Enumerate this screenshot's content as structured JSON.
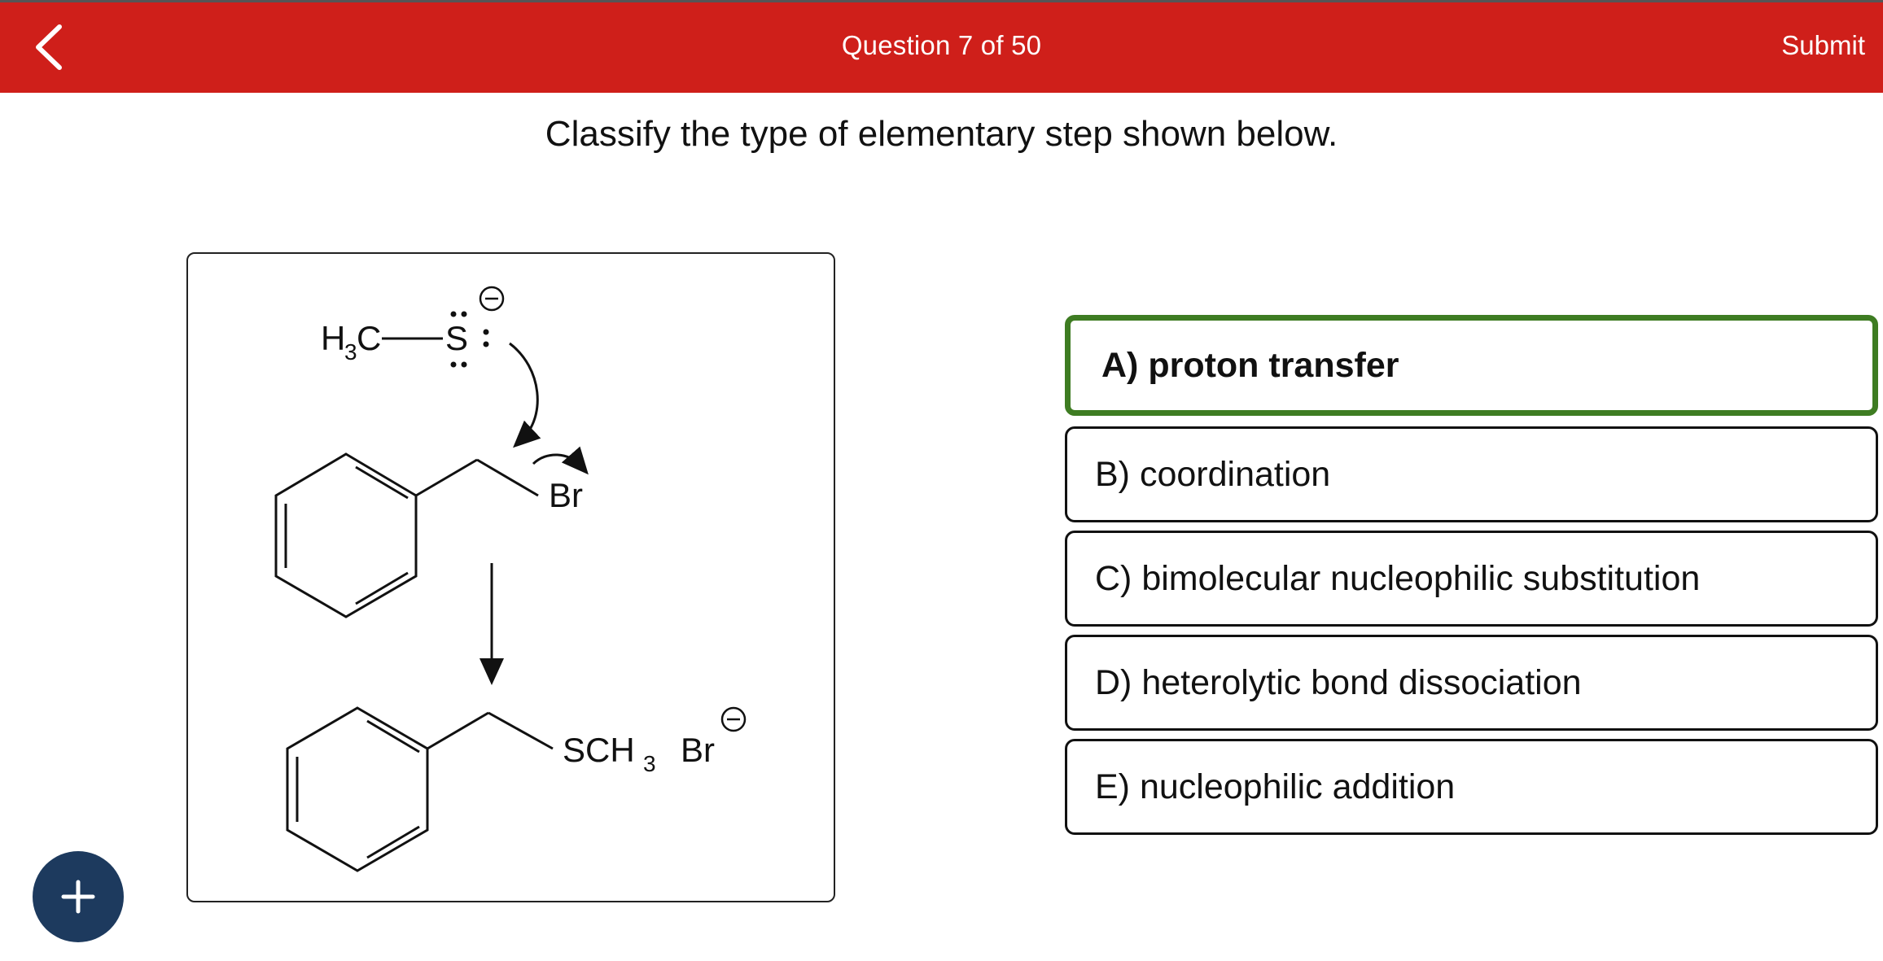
{
  "header": {
    "title": "Question 7 of 50",
    "submit_label": "Submit",
    "accent_color": "#cf1f1a"
  },
  "question": {
    "prompt": "Classify the type of elementary step shown below."
  },
  "diagram": {
    "reactant_methyl": "H",
    "reactant_methyl_sub": "3",
    "reactant_methyl_c": "C",
    "sulfur": "S",
    "leaving_group": "Br",
    "product_group_main": "SCH",
    "product_group_sub": "3",
    "bromide": "Br"
  },
  "options": [
    {
      "label": "A) proton transfer",
      "selected": true
    },
    {
      "label": "B) coordination",
      "selected": false
    },
    {
      "label": "C) bimolecular nucleophilic substitution",
      "selected": false
    },
    {
      "label": "D) heterolytic bond dissociation",
      "selected": false
    },
    {
      "label": "E) nucleophilic addition",
      "selected": false
    }
  ],
  "icons": {
    "back": "chevron-left-icon",
    "fab": "plus-icon"
  },
  "colors": {
    "selected_border": "#3e7c22",
    "fab": "#1d3a5e"
  }
}
